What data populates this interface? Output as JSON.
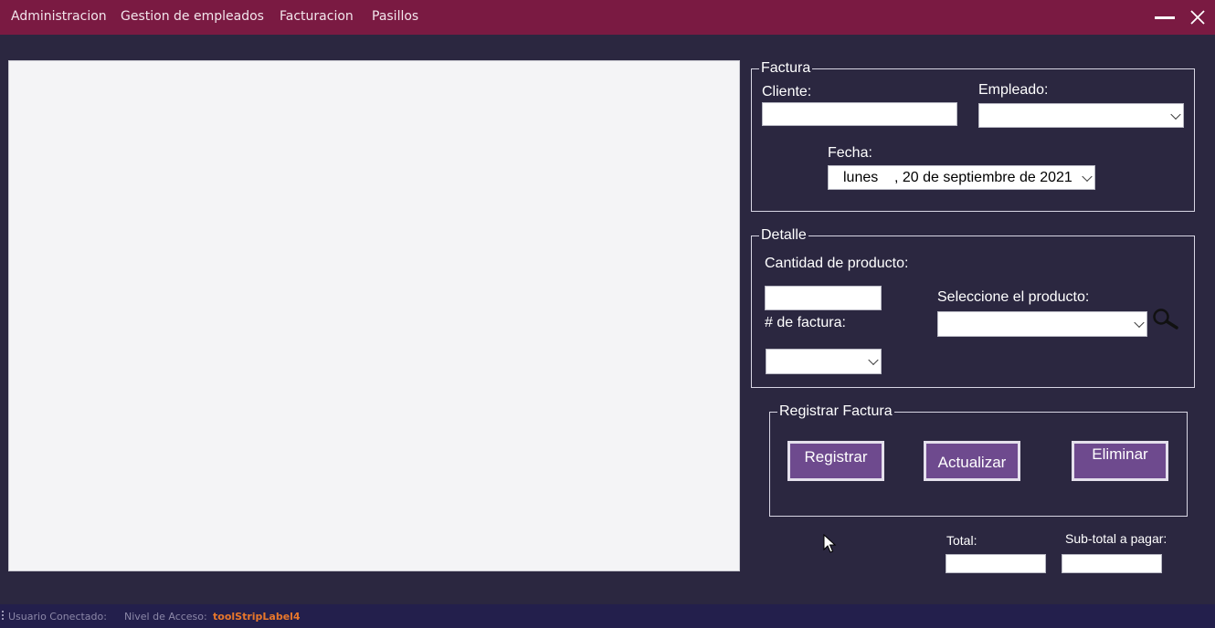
{
  "menu": {
    "items": [
      "Administracion",
      "Gestion de empleados",
      "Facturacion",
      "Pasillos"
    ]
  },
  "factura": {
    "legend": "Factura",
    "cliente_label": "Cliente:",
    "cliente_value": "",
    "empleado_label": "Empleado:",
    "empleado_value": "",
    "fecha_label": "Fecha:",
    "fecha_day": "lunes",
    "fecha_rest": ", 20 de septiembre de 2021"
  },
  "detalle": {
    "legend": "Detalle",
    "cantidad_label": "Cantidad de producto:",
    "cantidad_value": "",
    "factura_num_label": "# de factura:",
    "factura_num_value": "",
    "producto_label": "Seleccione el producto:",
    "producto_value": ""
  },
  "registrar": {
    "legend": "Registrar Factura",
    "registrar_label": "Registrar",
    "actualizar_label": "Actualizar",
    "eliminar_label": "Eliminar"
  },
  "totals": {
    "total_label": "Total:",
    "total_value": "",
    "subtotal_label": "Sub-total a pagar:",
    "subtotal_value": ""
  },
  "status": {
    "usuario_label": "Usuario Conectado:",
    "nivel_label": "Nivel de Acceso:",
    "nivel_value": "toolStripLabel4"
  },
  "colors": {
    "menubar": "#7a1a42",
    "background": "#2b2740",
    "button": "#6e4a8e",
    "statusbar": "#231f4c",
    "status_value": "#e8772b"
  },
  "icons": [
    "minimize-icon",
    "close-icon",
    "search-icon",
    "chevron-down-icon",
    "mouse-cursor-icon",
    "status-grip-icon"
  ]
}
